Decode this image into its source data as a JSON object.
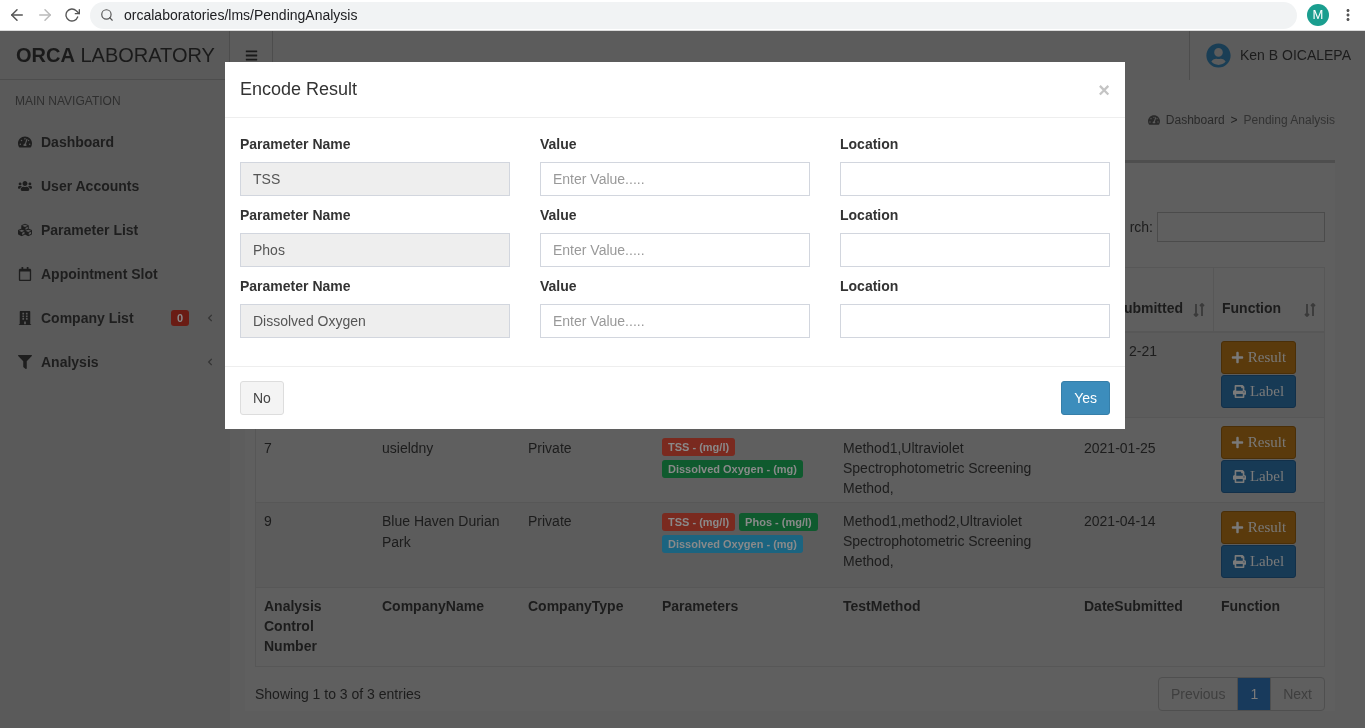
{
  "browser": {
    "url": "orcalaboratories/lms/PendingAnalysis",
    "profile_initial": "M"
  },
  "brand": {
    "strong": "ORCA",
    "rest": "LABORATORY"
  },
  "user": {
    "name": "Ken B OICALEPA"
  },
  "sidebar": {
    "heading": "MAIN NAVIGATION",
    "items": [
      {
        "label": "Dashboard",
        "has_submenu": false
      },
      {
        "label": "User Accounts",
        "has_submenu": false
      },
      {
        "label": "Parameter List",
        "has_submenu": false
      },
      {
        "label": "Appointment Slot",
        "has_submenu": false
      },
      {
        "label": "Company List",
        "badge": "0",
        "has_submenu": true
      },
      {
        "label": "Analysis",
        "has_submenu": true
      }
    ]
  },
  "breadcrumb": {
    "items": [
      "Dashboard",
      "Pending Analysis"
    ],
    "separator": ">"
  },
  "search": {
    "label": "rch:"
  },
  "table": {
    "header": [
      "ubmitted",
      "Function"
    ],
    "rows": [
      {
        "date": "2-21",
        "actions": [
          {
            "kind": "add",
            "label": "Result"
          },
          {
            "kind": "print",
            "label": "Label"
          }
        ]
      },
      {
        "number": "7",
        "company": "usieldny",
        "type": "Private",
        "parameters": [
          {
            "label": "TSS - (mg/l)",
            "color": "#7a2a1f"
          },
          {
            "label": "Dissolved Oxygen - (mg)",
            "color": "#0f5a2e"
          }
        ],
        "method": "Method1,Ultraviolet Spectrophotometric Screening Method,",
        "date": "2021-01-25",
        "actions": [
          {
            "kind": "add",
            "label": "Result"
          },
          {
            "kind": "print",
            "label": "Label"
          }
        ]
      },
      {
        "number": "9",
        "company": "Blue Haven Durian Park",
        "type": "Private",
        "parameters": [
          {
            "label": "TSS - (mg/l)",
            "color": "#7a2a1f"
          },
          {
            "label": "Phos - (mg/l)",
            "color": "#0f5a2e"
          },
          {
            "label": "Dissolved Oxygen - (mg)",
            "color": "#1b6480"
          }
        ],
        "method": "Method1,method2,Ultraviolet Spectrophotometric Screening Method,",
        "date": "2021-04-14",
        "actions": [
          {
            "kind": "add",
            "label": "Result"
          },
          {
            "kind": "print",
            "label": "Label"
          }
        ]
      }
    ],
    "footer": [
      "Analysis Control Number",
      "CompanyName",
      "CompanyType",
      "Parameters",
      "TestMethod",
      "DateSubmitted",
      "Function"
    ]
  },
  "info": "Showing 1 to 3 of 3 entries",
  "pagination": [
    {
      "label": "Previous",
      "selected": false
    },
    {
      "label": "1",
      "selected": true
    },
    {
      "label": "Next",
      "selected": false
    }
  ],
  "modal": {
    "title": "Encode Result",
    "close": "×",
    "fields": [
      {
        "name_label": "Parameter Name",
        "name": "TSS",
        "value_label": "Value",
        "value_placeholder": "Enter Value.....",
        "location_label": "Location"
      },
      {
        "name_label": "Parameter Name",
        "name": "Phos",
        "value_label": "Value",
        "value_placeholder": "Enter Value.....",
        "location_label": "Location"
      },
      {
        "name_label": "Parameter Name",
        "name": "Dissolved Oxygen",
        "value_label": "Value",
        "value_placeholder": "Enter Value.....",
        "location_label": "Location"
      }
    ],
    "cancel": "No",
    "confirm": "Yes"
  }
}
